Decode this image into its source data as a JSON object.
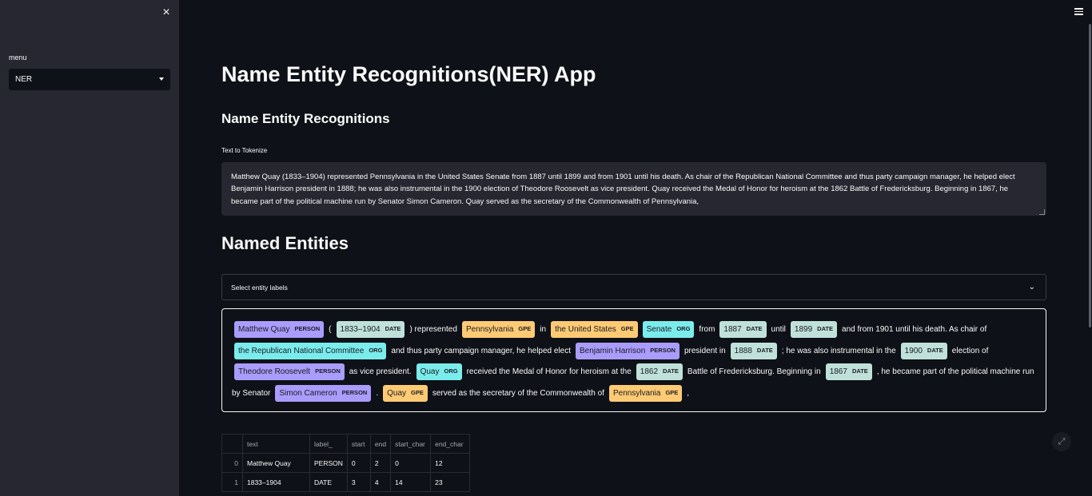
{
  "sidebar": {
    "close_icon": "×",
    "menu_label": "menu",
    "menu_value": "NER"
  },
  "header": {
    "hamburger_icon": "hamburger-icon"
  },
  "main": {
    "title": "Name Entity Recognitions(NER) App",
    "subtitle": "Name Entity Recognitions",
    "textarea_label": "Text to Tokenize",
    "textarea_value": "Matthew Quay (1833–1904) represented Pennsylvania in the United States Senate from 1887 until 1899 and from 1901 until his death. As chair of the Republican National Committee and thus party campaign manager, he helped elect Benjamin Harrison president in 1888; he was also instrumental in the 1900 election of Theodore Roosevelt as vice president. Quay received the Medal of Honor for heroism at the 1862 Battle of Fredericksburg. Beginning in 1867, he became part of the political machine run by Senator Simon Cameron. Quay served as the secretary of the Commonwealth of Pennsylvania,",
    "entities_heading": "Named Entities",
    "multiselect_placeholder": "Select entity labels",
    "entity_colors": {
      "PERSON": "#aa9cfc",
      "DATE": "#bfe1d9",
      "GPE": "#feca74",
      "ORG": "#7aecec"
    },
    "segments": [
      {
        "ent": "Matthew Quay",
        "label": "PERSON"
      },
      {
        "text": "("
      },
      {
        "ent": "1833–1904",
        "label": "DATE"
      },
      {
        "text": ") represented"
      },
      {
        "ent": "Pennsylvania",
        "label": "GPE"
      },
      {
        "text": "in"
      },
      {
        "ent": "the United States",
        "label": "GPE"
      },
      {
        "ent": "Senate",
        "label": "ORG"
      },
      {
        "text": "from"
      },
      {
        "ent": "1887",
        "label": "DATE"
      },
      {
        "text": "until"
      },
      {
        "ent": "1899",
        "label": "DATE"
      },
      {
        "text": "and from 1901 until his death. As chair of"
      },
      {
        "ent": "the Republican National Committee",
        "label": "ORG"
      },
      {
        "text": "and thus party campaign manager, he helped elect"
      },
      {
        "ent": "Benjamin Harrison",
        "label": "PERSON"
      },
      {
        "text": "president in"
      },
      {
        "ent": "1888",
        "label": "DATE"
      },
      {
        "text": "; he was also instrumental in the"
      },
      {
        "ent": "1900",
        "label": "DATE"
      },
      {
        "text": "election of"
      },
      {
        "ent": "Theodore Roosevelt",
        "label": "PERSON"
      },
      {
        "text": "as vice president."
      },
      {
        "ent": "Quay",
        "label": "ORG"
      },
      {
        "text": "received the Medal of Honor for heroism at the"
      },
      {
        "ent": "1862",
        "label": "DATE"
      },
      {
        "text": "Battle of Fredericksburg. Beginning in"
      },
      {
        "ent": "1867",
        "label": "DATE"
      },
      {
        "text": ", he became part of the political machine run by Senator"
      },
      {
        "ent": "Simon Cameron",
        "label": "PERSON"
      },
      {
        "text": "."
      },
      {
        "ent": "Quay",
        "label": "GPE"
      },
      {
        "text": "served as the secretary of the Commonwealth of"
      },
      {
        "ent": "Pennsylvania",
        "label": "GPE"
      },
      {
        "text": ","
      }
    ],
    "table": {
      "columns": [
        "",
        "text",
        "label_",
        "start",
        "end",
        "start_char",
        "end_char"
      ],
      "rows": [
        [
          "0",
          "Matthew Quay",
          "PERSON",
          "0",
          "2",
          "0",
          "12"
        ],
        [
          "1",
          "1833–1904",
          "DATE",
          "3",
          "4",
          "14",
          "23"
        ]
      ]
    }
  }
}
